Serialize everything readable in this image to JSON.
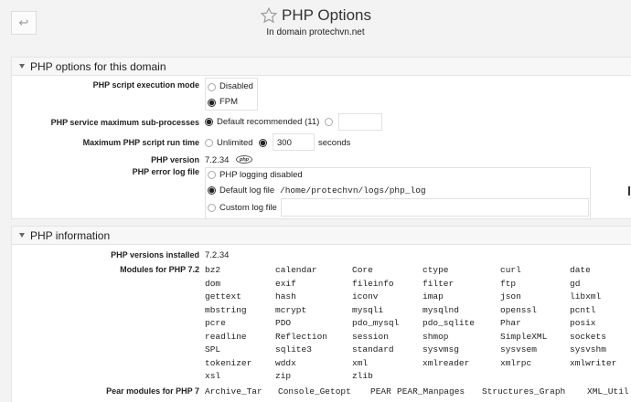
{
  "header": {
    "title": "PHP Options",
    "subtitle": "In domain protechvn.net"
  },
  "options": {
    "section_title": "PHP options for this domain",
    "exec_mode": {
      "label": "PHP script execution mode",
      "opt_disabled": "Disabled",
      "opt_fpm": "FPM"
    },
    "max_sub": {
      "label": "PHP service maximum sub-processes",
      "opt_default": "Default recommended (11)",
      "custom_value": ""
    },
    "max_runtime": {
      "label": "Maximum PHP script run time",
      "opt_unlimited": "Unlimited",
      "value": "300",
      "unit": "seconds"
    },
    "version": {
      "label": "PHP version",
      "value": "7.2.34",
      "logo_text": "php"
    },
    "error_log": {
      "label": "PHP error log file",
      "opt_disabled": "PHP logging disabled",
      "opt_default": "Default log file",
      "default_path": "/home/protechvn/logs/php_log",
      "opt_custom": "Custom log file",
      "custom_value": ""
    }
  },
  "info": {
    "section_title": "PHP information",
    "versions_label": "PHP versions installed",
    "versions_value": "7.2.34",
    "modules_label": "Modules for PHP 7.2",
    "modules": [
      [
        "bz2",
        "calendar",
        "Core",
        "ctype",
        "curl",
        "date"
      ],
      [
        "dom",
        "exif",
        "fileinfo",
        "filter",
        "ftp",
        "gd"
      ],
      [
        "gettext",
        "hash",
        "iconv",
        "imap",
        "json",
        "libxml"
      ],
      [
        "mbstring",
        "mcrypt",
        "mysqli",
        "mysqlnd",
        "openssl",
        "pcntl"
      ],
      [
        "pcre",
        "PDO",
        "pdo_mysql",
        "pdo_sqlite",
        "Phar",
        "posix"
      ],
      [
        "readline",
        "Reflection",
        "session",
        "shmop",
        "SimpleXML",
        "sockets"
      ],
      [
        "SPL",
        "sqlite3",
        "standard",
        "sysvmsg",
        "sysvsem",
        "sysvshm"
      ],
      [
        "tokenizer",
        "wddx",
        "xml",
        "xmlreader",
        "xmlrpc",
        "xmlwriter"
      ],
      [
        "xsl",
        "zip",
        "zlib"
      ]
    ],
    "pear_label": "Pear modules for PHP 7",
    "pear_modules": [
      "Archive_Tar",
      "Console_Getopt",
      "PEAR",
      "PEAR_Manpages",
      "Structures_Graph",
      "XML_Util"
    ]
  }
}
